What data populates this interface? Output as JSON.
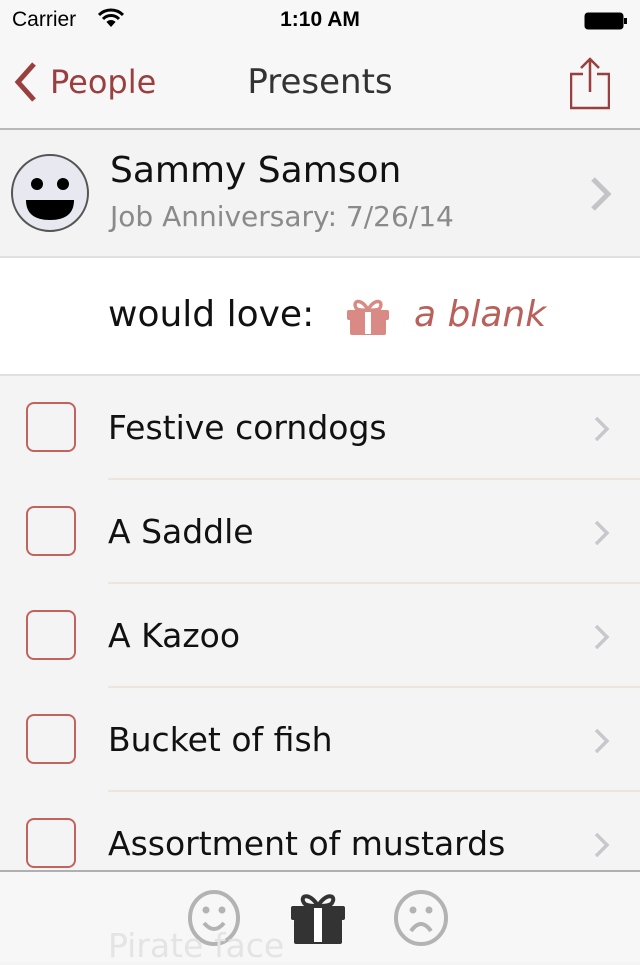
{
  "status_bar": {
    "carrier": "Carrier",
    "time": "1:10 AM"
  },
  "nav": {
    "back_label": "People",
    "title": "Presents"
  },
  "person": {
    "name": "Sammy Samson",
    "occasion": "Job Anniversary: 7/26/14"
  },
  "would_love": {
    "label": "would love:",
    "value": "a blank"
  },
  "presents": [
    {
      "label": "Festive corndogs",
      "checked": false
    },
    {
      "label": "A Saddle",
      "checked": false
    },
    {
      "label": "A Kazoo",
      "checked": false
    },
    {
      "label": "Bucket of fish",
      "checked": false
    },
    {
      "label": "Assortment of mustards",
      "checked": false
    }
  ],
  "hidden_row": "Pirate face",
  "tabs": [
    {
      "name": "happy",
      "icon": "smiley-icon",
      "active": false
    },
    {
      "name": "presents",
      "icon": "gift-icon",
      "active": true
    },
    {
      "name": "sad",
      "icon": "frown-icon",
      "active": false
    }
  ],
  "colors": {
    "accent": "#9a3f3f",
    "gift": "#d98a84",
    "checkbox": "#c0645e"
  }
}
